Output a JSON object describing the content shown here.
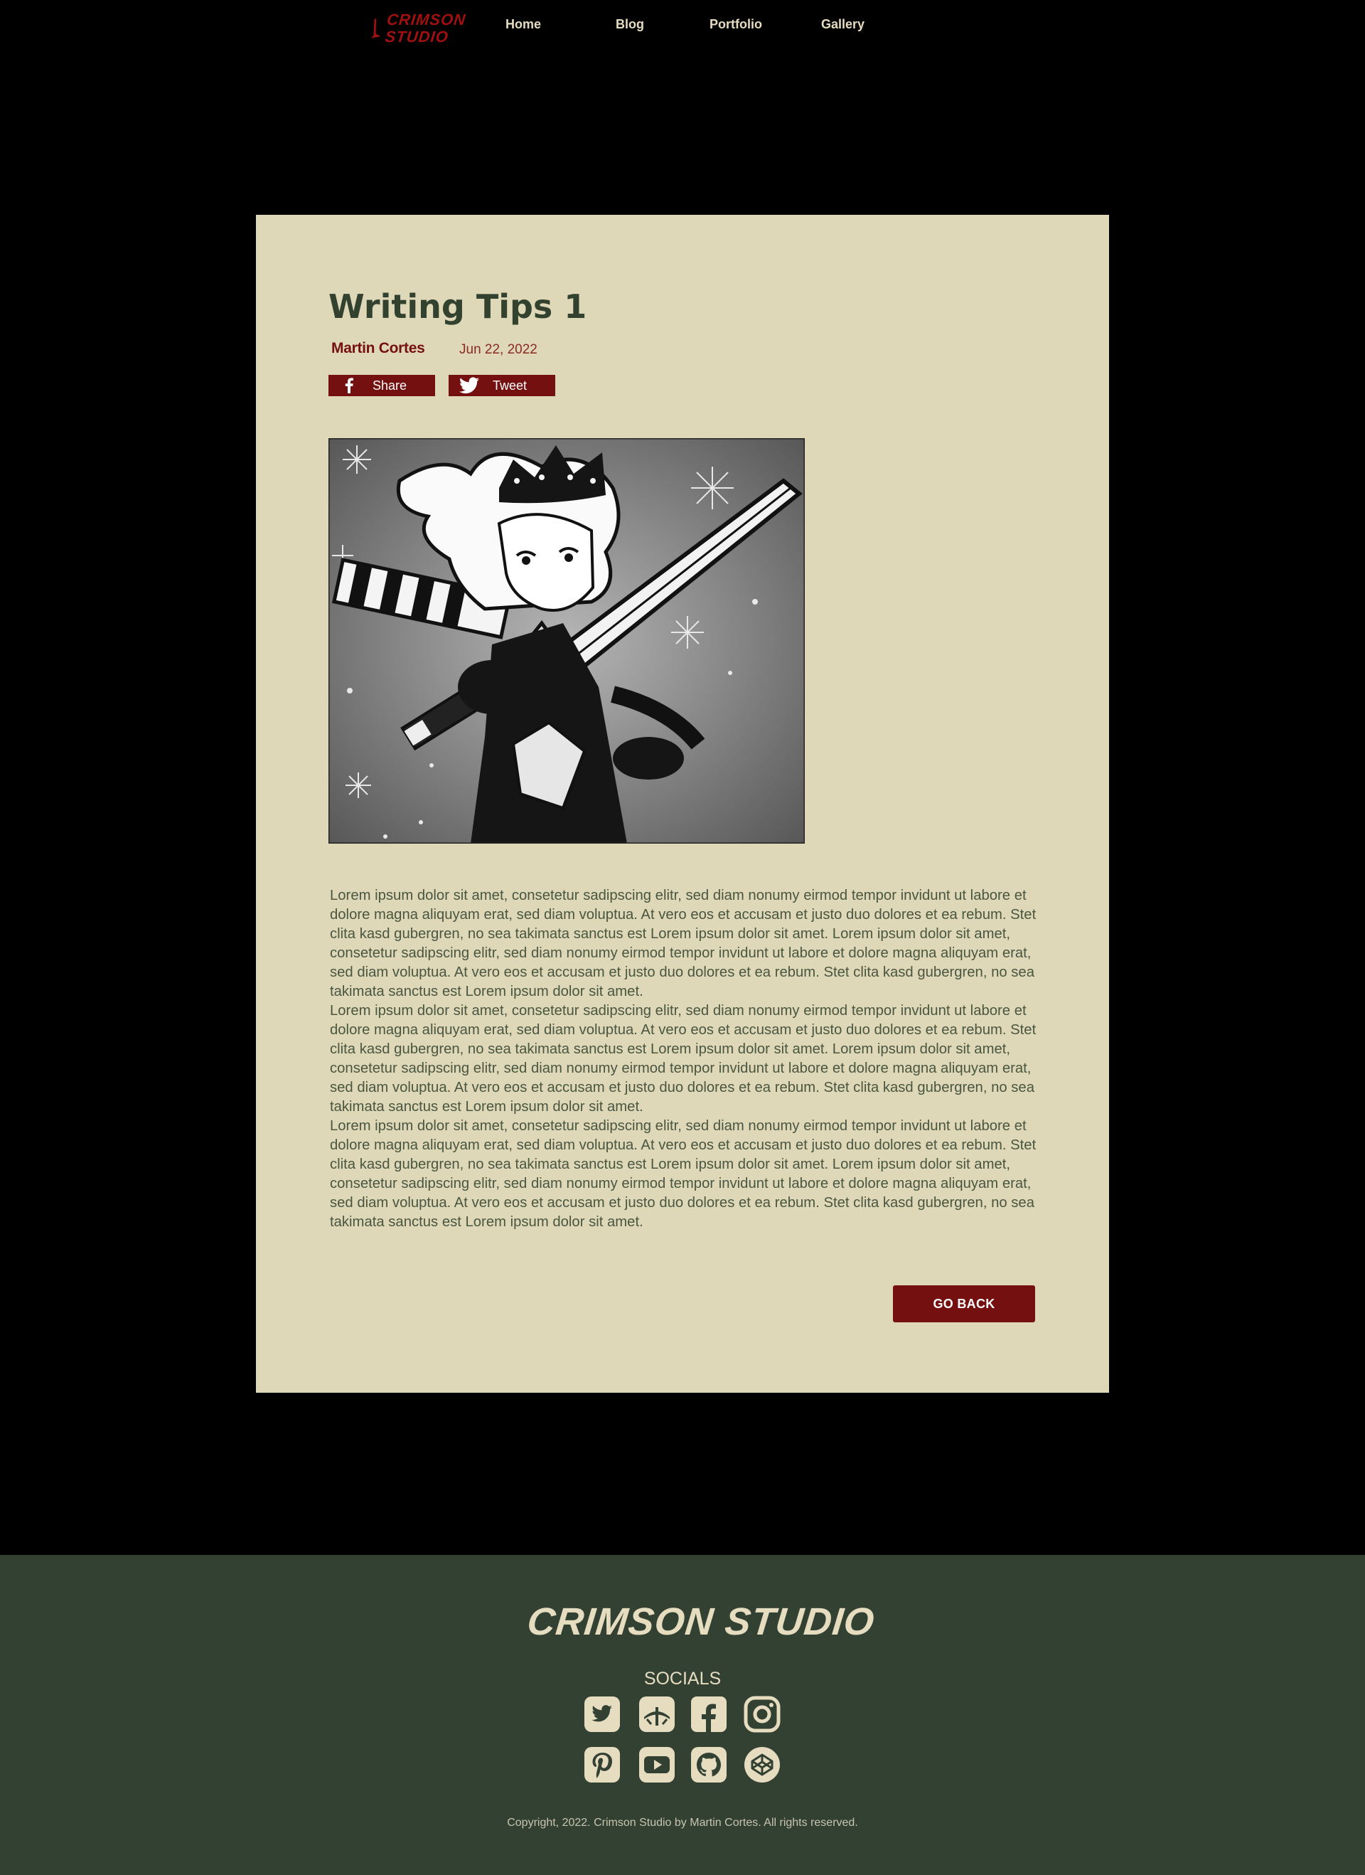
{
  "header": {
    "logo": {
      "line1": "CRIMSON",
      "line2": "STUDIO"
    },
    "nav": [
      "Home",
      "Blog",
      "Portfolio",
      "Gallery"
    ]
  },
  "post": {
    "title": "Writing Tips 1",
    "author": "Martin Cortes",
    "date": "Jun 22, 2022",
    "share_label": "Share",
    "tweet_label": "Tweet",
    "image_icon": "manga-swordsman-illustration",
    "paragraphs": [
      "Lorem ipsum dolor sit amet, consetetur sadipscing elitr, sed diam nonumy eirmod tempor invidunt ut labore et dolore magna aliquyam erat, sed diam voluptua. At vero eos et accusam et justo duo dolores et ea rebum. Stet clita kasd gubergren, no sea takimata sanctus est Lorem ipsum dolor sit amet. Lorem ipsum dolor sit amet, consetetur sadipscing elitr, sed diam nonumy eirmod tempor invidunt ut labore et dolore magna aliquyam erat, sed diam voluptua. At vero eos et accusam et justo duo dolores et ea rebum. Stet clita kasd gubergren, no sea takimata sanctus est Lorem ipsum dolor sit amet.",
      "Lorem ipsum dolor sit amet, consetetur sadipscing elitr, sed diam nonumy eirmod tempor invidunt ut labore et dolore magna aliquyam erat, sed diam voluptua. At vero eos et accusam et justo duo dolores et ea rebum. Stet clita kasd gubergren, no sea takimata sanctus est Lorem ipsum dolor sit amet. Lorem ipsum dolor sit amet, consetetur sadipscing elitr, sed diam nonumy eirmod tempor invidunt ut labore et dolore magna aliquyam erat, sed diam voluptua. At vero eos et accusam et justo duo dolores et ea rebum. Stet clita kasd gubergren, no sea takimata sanctus est Lorem ipsum dolor sit amet.",
      "Lorem ipsum dolor sit amet, consetetur sadipscing elitr, sed diam nonumy eirmod tempor invidunt ut labore et dolore magna aliquyam erat, sed diam voluptua. At vero eos et accusam et justo duo dolores et ea rebum. Stet clita kasd gubergren, no sea takimata sanctus est Lorem ipsum dolor sit amet. Lorem ipsum dolor sit amet, consetetur sadipscing elitr, sed diam nonumy eirmod tempor invidunt ut labore et dolore magna aliquyam erat, sed diam voluptua. At vero eos et accusam et justo duo dolores et ea rebum. Stet clita kasd gubergren, no sea takimata sanctus est Lorem ipsum dolor sit amet."
    ],
    "go_back_label": "GO BACK"
  },
  "footer": {
    "logo_text": "CRIMSON STUDIO",
    "socials_heading": "SOCIALS",
    "socials": [
      "twitter-icon",
      "deviantart-icon",
      "facebook-icon",
      "instagram-icon",
      "pinterest-icon",
      "youtube-icon",
      "github-icon",
      "codepen-icon"
    ],
    "copyright": "Copyright, 2022. Crimson Studio by Martin Cortes. All rights reserved."
  },
  "colors": {
    "background": "#000000",
    "card": "#ded8b9",
    "accent": "#751010",
    "title": "#33422f",
    "footer": "#334133",
    "cream": "#e6dcc0"
  }
}
